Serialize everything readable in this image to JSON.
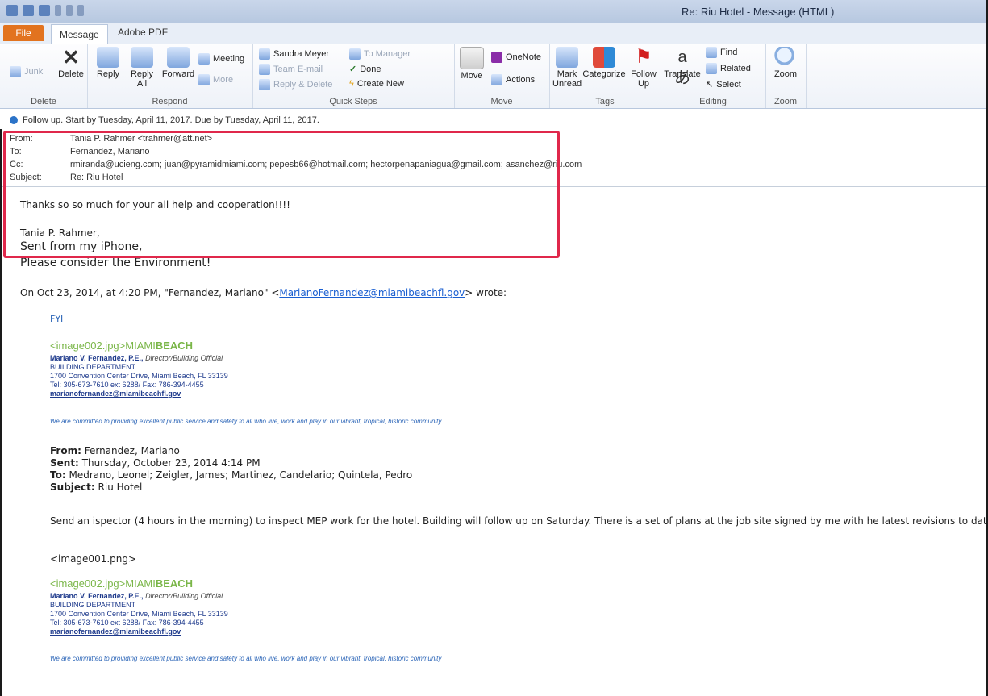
{
  "window": {
    "title": "Re: Riu Hotel - Message (HTML)"
  },
  "tabs": {
    "file": "File",
    "message": "Message",
    "adobe": "Adobe PDF"
  },
  "ribbon": {
    "delete_group": {
      "junk": "Junk",
      "delete": "Delete",
      "label": "Delete"
    },
    "respond_group": {
      "reply": "Reply",
      "reply_all_1": "Reply",
      "reply_all_2": "All",
      "forward": "Forward",
      "meeting": "Meeting",
      "more": "More",
      "label": "Respond"
    },
    "quick_steps": {
      "items": [
        "Sandra Meyer",
        "Team E-mail",
        "Reply & Delete",
        "To Manager",
        "Done",
        "Create New"
      ],
      "label": "Quick Steps"
    },
    "move_group": {
      "move": "Move",
      "onenote": "OneNote",
      "actions": "Actions",
      "label": "Move"
    },
    "tags_group": {
      "mark_unread_1": "Mark",
      "mark_unread_2": "Unread",
      "categorize": "Categorize",
      "follow_up_1": "Follow",
      "follow_up_2": "Up",
      "label": "Tags"
    },
    "editing_group": {
      "translate": "Translate",
      "find": "Find",
      "related": "Related",
      "select": "Select",
      "label": "Editing"
    },
    "zoom_group": {
      "zoom": "Zoom",
      "label": "Zoom"
    }
  },
  "info_bar": "Follow up.  Start by Tuesday, April 11, 2017.  Due by Tuesday, April 11, 2017.",
  "header": {
    "from_label": "From:",
    "from": "Tania P. Rahmer <trahmer@att.net>",
    "to_label": "To:",
    "to": "Fernandez, Mariano",
    "cc_label": "Cc:",
    "cc": "rmiranda@ucieng.com; juan@pyramidmiami.com; pepesb66@hotmail.com; hectorpenapaniagua@gmail.com; asanchez@riu.com",
    "subject_label": "Subject:",
    "subject": "Re: Riu Hotel"
  },
  "body": {
    "line1": "Thanks so so much for your all help and cooperation!!!!",
    "sig_name": "Tania P. Rahmer,",
    "sent_from": "Sent from my iPhone,",
    "env": "Please consider the Environment!",
    "quote_intro_a": "On Oct 23, 2014, at 4:20 PM, \"Fernandez, Mariano\" <",
    "quote_email": "MarianoFernandez@miamibeachfl.gov",
    "quote_intro_b": "> wrote:",
    "fyi": "FYI"
  },
  "signature": {
    "image_tag": "<image002.jpg>",
    "miami": "MIAMI",
    "beach": "BEACH",
    "name": "Mariano V. Fernandez, P.E.,",
    "title": "Director/Building Official",
    "dept": "BUILDING DEPARTMENT",
    "address": "1700 Convention Center Drive, Miami Beach, FL 33139",
    "tel": "Tel: 305-673-7610 ext 6288/ Fax: 786-394-4455",
    "email": "marianofernandez@miamibeachfl.gov",
    "motto": "We are committed to providing excellent public service and safety to all who live, work and play in our vibrant, tropical, historic community"
  },
  "forwarded": {
    "from_label": "From:",
    "from": "Fernandez, Mariano",
    "sent_label": "Sent:",
    "sent": "Thursday, October 23, 2014 4:14 PM",
    "to_label": "To:",
    "to": "Medrano, Leonel; Zeigler, James; Martinez, Candelario; Quintela, Pedro",
    "subject_label": "Subject:",
    "subject": "Riu Hotel",
    "body": "Send an ispector (4 hours in the morning) to inspect MEP work for the hotel. Building will follow up on Saturday. There is a set of plans at the job site signed by me with he latest revisions to date .",
    "image1": "<image001.png>"
  },
  "colors": {
    "highlight": "#e0284b",
    "link": "#1a5fd1",
    "file_tab": "#e2731f",
    "miami_green": "#7ab648"
  }
}
